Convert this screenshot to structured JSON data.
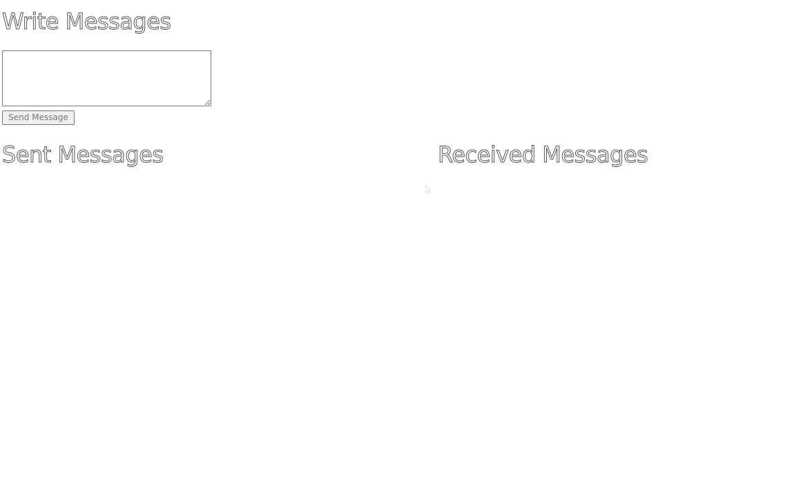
{
  "write": {
    "heading": "Write Messages",
    "input_value": "",
    "input_placeholder": "",
    "send_label": "Send Message"
  },
  "sent": {
    "heading": "Sent Messages",
    "items": []
  },
  "received": {
    "heading": "Received Messages",
    "items": []
  },
  "icons": {
    "pointer": "mouse-pointer-icon"
  }
}
